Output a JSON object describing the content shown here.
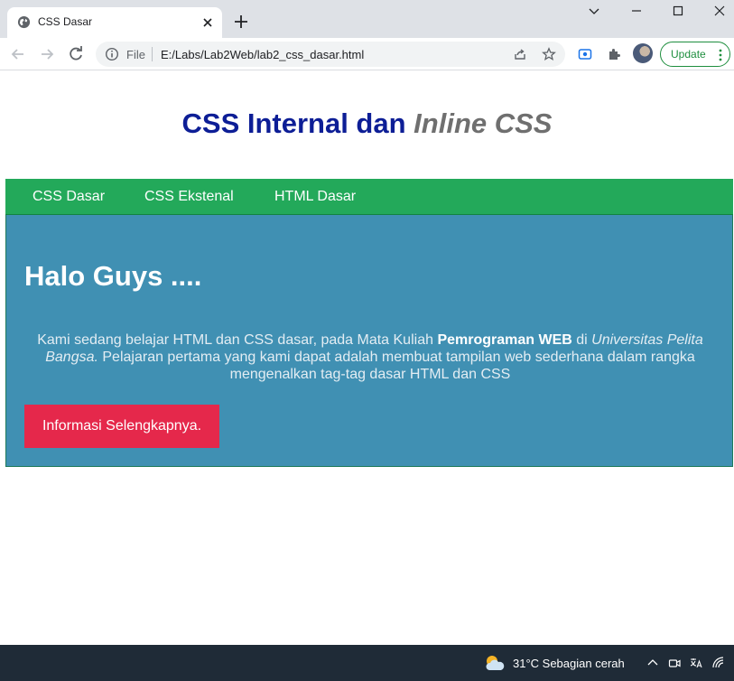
{
  "browser": {
    "tab": {
      "title": "CSS Dasar",
      "favicon": "globe-icon"
    },
    "window_controls": [
      "chevron-down-icon",
      "minimize-icon",
      "maximize-icon",
      "close-icon"
    ],
    "toolbar": {
      "scheme_label": "File",
      "url": "E:/Labs/Lab2Web/lab2_css_dasar.html",
      "update_label": "Update"
    }
  },
  "page": {
    "title_main": "CSS Internal dan ",
    "title_italic": "Inline CSS",
    "nav": [
      {
        "label": "CSS Dasar"
      },
      {
        "label": "CSS Ekstenal"
      },
      {
        "label": "HTML Dasar"
      }
    ],
    "hero": {
      "heading": "Halo Guys ....",
      "text_part1": "Kami sedang belajar HTML dan CSS dasar, pada Mata Kuliah ",
      "text_bold": "Pemrograman WEB",
      "text_part2": " di ",
      "text_italic": "Universitas Pelita Bangsa.",
      "text_part3": " Pelajaran pertama yang kami dapat adalah membuat tampilan web sederhana dalam rangka mengenalkan tag-tag dasar HTML dan CSS",
      "button_label": "Informasi Selengkapnya."
    }
  },
  "taskbar": {
    "weather": "31°C  Sebagian cerah",
    "weather_icon": "partly-cloudy-icon"
  },
  "colors": {
    "title_blue": "#0d1e96",
    "title_gray": "#6f6f6f",
    "nav_green": "#23a95a",
    "hero_blue": "#4090b3",
    "button_red": "#e5284b",
    "taskbar": "#1f2b37"
  }
}
